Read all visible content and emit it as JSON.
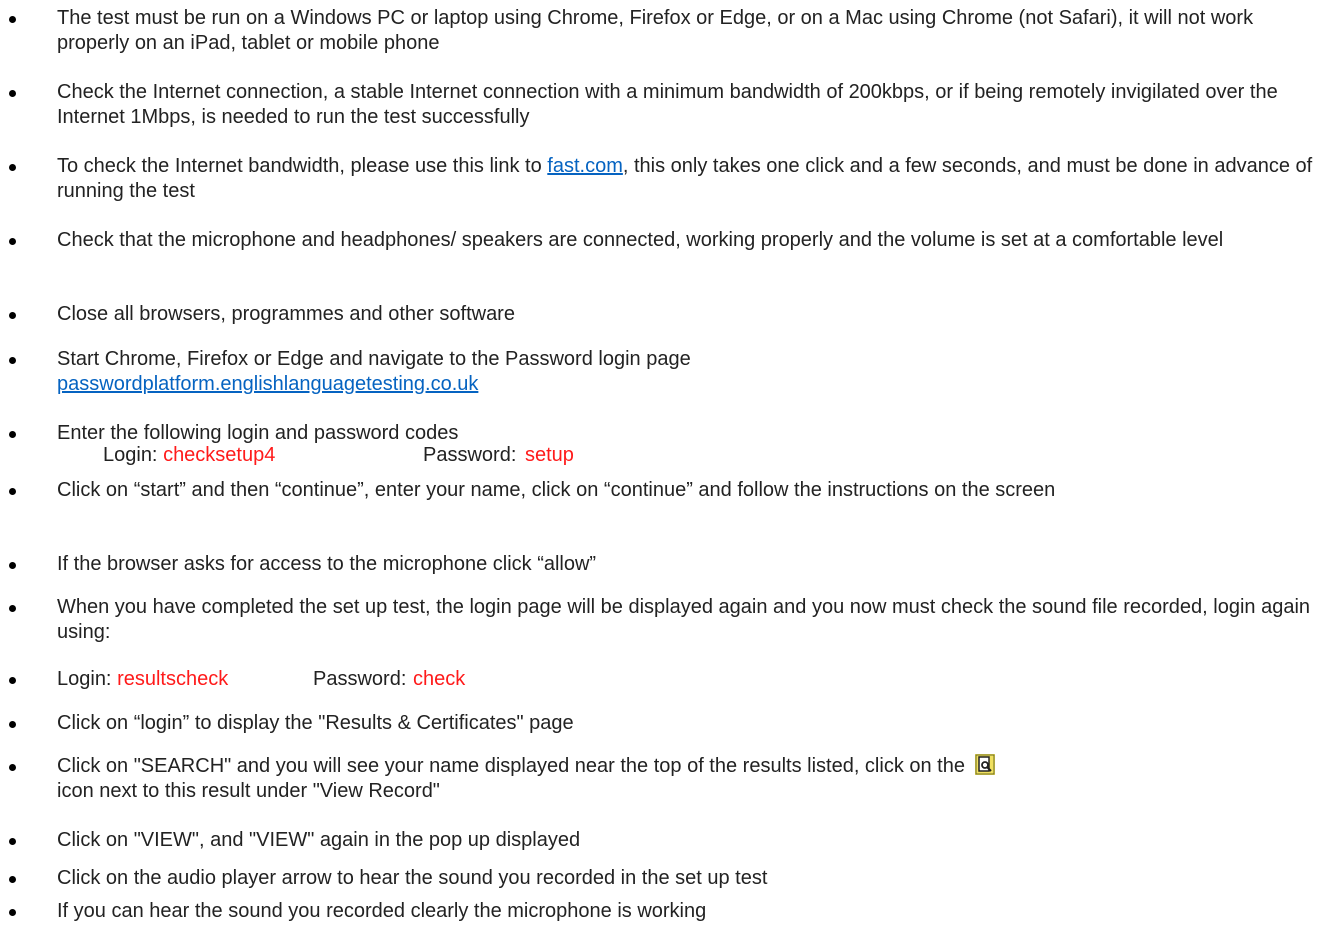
{
  "items": [
    {
      "text": "The test must be run on a Windows PC or laptop using Chrome, Firefox or Edge, or on a Mac using Chrome (not Safari), it will not work properly on an iPad, tablet or mobile phone"
    },
    {
      "text": "Check the Internet connection, a stable Internet connection with a minimum bandwidth of 200kbps, or if being remotely invigilated over the Internet 1Mbps, is needed to run the test successfully"
    },
    {
      "before": "To check the Internet bandwidth, please use this link to ",
      "link": "fast.com",
      "after": ", this only takes one click and a few seconds, and must be done in advance of running the test"
    },
    {
      "text": "Check that the microphone and headphones/ speakers are connected, working properly and the volume is set at a comfortable level"
    },
    {
      "text": "Close all browsers, programmes and other software"
    },
    {
      "text": "Start Chrome, Firefox or Edge and navigate to the Password login page",
      "link": "passwordplatform.englishlanguagetesting.co.uk"
    },
    {
      "text": "Enter the following login and password codes",
      "login_label": "Login: ",
      "login_value": "checksetup4",
      "password_label": "Password: ",
      "password_value": "setup"
    },
    {
      "text": "Click on “start” and then “continue”, enter your name, click on “continue” and follow the instructions on the screen"
    },
    {
      "text": "If the browser asks for access to the microphone click “allow”"
    },
    {
      "text": "When you have completed the set up test, the login page will be displayed again and you now must check the sound file recorded, login again using:"
    },
    {
      "login_label": "Login: ",
      "login_value": "resultscheck",
      "password_label": "Password: ",
      "password_value": "check"
    },
    {
      "text": "Click on “login” to display the \"Results & Certificates\" page"
    },
    {
      "before": "Click on \"SEARCH\" and you will see your name displayed near the top of the results listed, click on the",
      "icon": "view-record-icon",
      "after": "icon next to this result under \"View Record\""
    },
    {
      "text": "Click on \"VIEW\", and \"VIEW\" again in the pop up displayed"
    },
    {
      "text": "Click on the audio player arrow to hear the sound you recorded in the set up test"
    },
    {
      "text": "If you can hear the sound you recorded clearly the microphone is working"
    }
  ],
  "colors": {
    "text": "#222222",
    "link": "#0563c1",
    "credential": "#ff1a1a",
    "icon_bg": "#f0e060"
  }
}
